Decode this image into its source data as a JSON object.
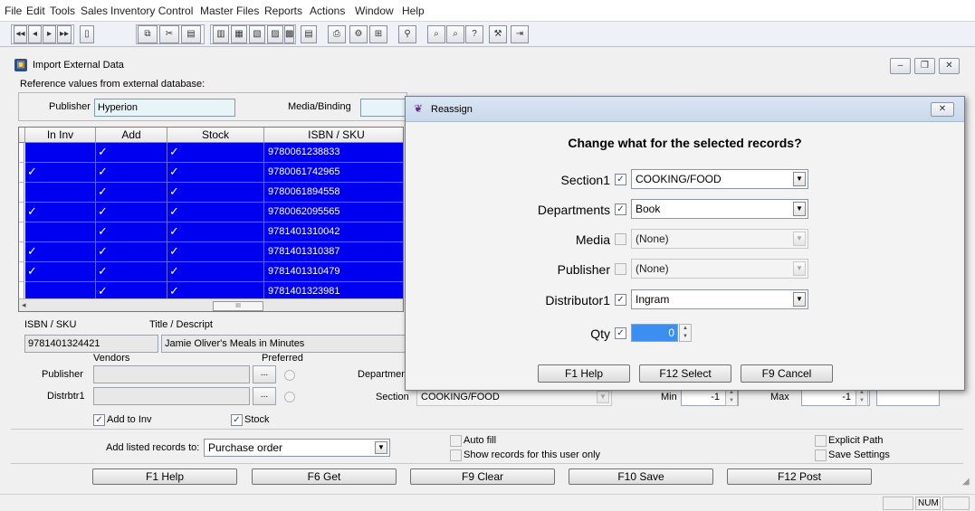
{
  "menu": [
    "File",
    "Edit",
    "Tools",
    "Sales",
    "Inventory Control",
    "Master Files",
    "Reports",
    "Actions",
    "Window",
    "Help"
  ],
  "window": {
    "title": "Import External Data",
    "ref_caption": "Reference values from external database:"
  },
  "ref": {
    "publisher_label": "Publisher",
    "publisher_value": "Hyperion",
    "media_label": "Media/Binding",
    "media_value": ""
  },
  "grid": {
    "columns": [
      "In Inv",
      "Add",
      "Stock",
      "ISBN / SKU"
    ],
    "rows": [
      {
        "in_inv": false,
        "add": true,
        "stock": true,
        "isbn": "9780061238833"
      },
      {
        "in_inv": true,
        "add": true,
        "stock": true,
        "isbn": "9780061742965"
      },
      {
        "in_inv": false,
        "add": true,
        "stock": true,
        "isbn": "9780061894558"
      },
      {
        "in_inv": true,
        "add": true,
        "stock": true,
        "isbn": "9780062095565"
      },
      {
        "in_inv": false,
        "add": true,
        "stock": true,
        "isbn": "9781401310042"
      },
      {
        "in_inv": true,
        "add": true,
        "stock": true,
        "isbn": "9781401310387"
      },
      {
        "in_inv": true,
        "add": true,
        "stock": true,
        "isbn": "9781401310479"
      },
      {
        "in_inv": false,
        "add": true,
        "stock": true,
        "isbn": "9781401323981"
      }
    ],
    "check_glyph": "✓",
    "hscroll_grip": "III"
  },
  "detail": {
    "isbn_label": "ISBN / SKU",
    "isbn_value": "9781401324421",
    "title_label": "Title / Descript",
    "title_value": "Jamie Oliver's Meals in Minutes",
    "vendors_label": "Vendors",
    "preferred_label": "Preferred",
    "publisher_label": "Publisher",
    "distributor_label": "Distrbtr1",
    "dots": "...",
    "department_label": "Departmen",
    "section_label": "Section",
    "section_value": "COOKING/FOOD",
    "min_label": "Min",
    "min_value": "-1",
    "max_label": "Max",
    "max_value": "-1",
    "add_to_inv_label": "Add to Inv",
    "stock_label": "Stock",
    "add_listed_label": "Add listed records to:",
    "add_listed_value": "Purchase order",
    "auto_fill_label": "Auto fill",
    "show_records_label": "Show records for this user only",
    "explicit_path_label": "Explicit Path",
    "save_settings_label": "Save Settings"
  },
  "footer_buttons": [
    "F1 Help",
    "F6 Get",
    "F9 Clear",
    "F10 Save",
    "F12 Post"
  ],
  "status": {
    "num": "NUM"
  },
  "dialog": {
    "title": "Reassign",
    "heading": "Change what for the selected records?",
    "rows": [
      {
        "label": "Section1",
        "checked": true,
        "value": "COOKING/FOOD",
        "enabled": true
      },
      {
        "label": "Departments",
        "checked": true,
        "value": "Book",
        "enabled": true
      },
      {
        "label": "Media",
        "checked": false,
        "value": "(None)",
        "enabled": false
      },
      {
        "label": "Publisher",
        "checked": false,
        "value": "(None)",
        "enabled": false
      },
      {
        "label": "Distributor1",
        "checked": true,
        "value": "Ingram",
        "enabled": true
      }
    ],
    "qty_label": "Qty",
    "qty_checked": true,
    "qty_value": "0",
    "buttons": {
      "help": "F1 Help",
      "select": "F12 Select",
      "cancel": "F9 Cancel"
    },
    "close_glyph": "✕"
  },
  "colors": {
    "selection": "#0000f0",
    "qty_highlight": "#3c8ef0"
  }
}
